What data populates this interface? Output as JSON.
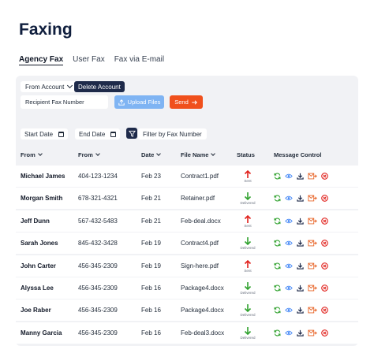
{
  "page": {
    "title": "Faxing"
  },
  "tabs": [
    {
      "label": "Agency Fax",
      "active": true
    },
    {
      "label": "User Fax",
      "active": false
    },
    {
      "label": "Fax via E-mail",
      "active": false
    }
  ],
  "toolbar": {
    "from_account_label": "From Account",
    "delete_account_label": "Delete Account",
    "recipient_placeholder": "Recipient Fax Number",
    "upload_label": "Upload Files",
    "send_label": "Send",
    "start_date_label": "Start Date",
    "end_date_label": "End Date",
    "filter_label": "Filter by Fax Number"
  },
  "table": {
    "headers": [
      "From",
      "From",
      "Date",
      "File Name",
      "Status",
      "Message Control"
    ],
    "rows": [
      {
        "name": "Michael James",
        "from": "404-123-1234",
        "date": "Feb 23",
        "file": "Contract1.pdf",
        "status": "Sent"
      },
      {
        "name": "Morgan Smith",
        "from": "678-321-4321",
        "date": "Feb 21",
        "file": "Retainer.pdf",
        "status": "Delivered"
      },
      {
        "name": "Jeff Dunn",
        "from": "567-432-5483",
        "date": "Feb 21",
        "file": "Feb-deal.docx",
        "status": "Sent"
      },
      {
        "name": "Sarah Jones",
        "from": "845-432-3428",
        "date": "Feb 19",
        "file": "Contract4.pdf",
        "status": "Delivered"
      },
      {
        "name": "John Carter",
        "from": "456-345-2309",
        "date": "Feb 19",
        "file": "Sign-here.pdf",
        "status": "Sent"
      },
      {
        "name": "Alyssa Lee",
        "from": "456-345-2309",
        "date": "Feb 16",
        "file": "Package4.docx",
        "status": "Delivered"
      },
      {
        "name": "Joe Raber",
        "from": "456-345-2309",
        "date": "Feb 16",
        "file": "Package4.docx",
        "status": "Delivered"
      },
      {
        "name": "Manny Garcia",
        "from": "456-345-2309",
        "date": "Feb 16",
        "file": "Feb-deal3.docx",
        "status": "Delivered"
      }
    ]
  },
  "colors": {
    "sent": "#e0201b",
    "delivered": "#2fa12d",
    "accent_orange": "#f0501c",
    "accent_blue": "#7fb4f3",
    "navy": "#1e2a4a"
  },
  "icons": {
    "controls": [
      "refresh-icon",
      "view-icon",
      "download-icon",
      "forward-icon",
      "delete-icon"
    ]
  }
}
